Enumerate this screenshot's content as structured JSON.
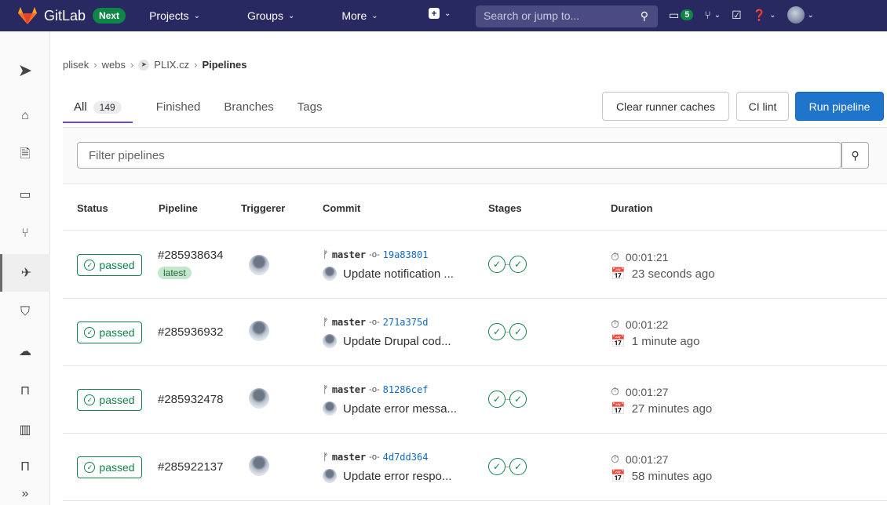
{
  "topbar": {
    "brand": "GitLab",
    "badge": "Next",
    "nav": [
      {
        "label": "Projects"
      },
      {
        "label": "Groups"
      },
      {
        "label": "More"
      }
    ],
    "search_placeholder": "Search or jump to...",
    "issues_count": "5"
  },
  "breadcrumb": {
    "items": [
      "plisek",
      "webs",
      "PLIX.cz"
    ],
    "current": "Pipelines"
  },
  "tabs": [
    {
      "label": "All",
      "count": "149"
    },
    {
      "label": "Finished"
    },
    {
      "label": "Branches"
    },
    {
      "label": "Tags"
    }
  ],
  "actions": {
    "clear_cache": "Clear runner caches",
    "ci_lint": "CI lint",
    "run_pipeline": "Run pipeline"
  },
  "filter": {
    "placeholder": "Filter pipelines"
  },
  "table": {
    "headers": {
      "status": "Status",
      "pipeline": "Pipeline",
      "triggerer": "Triggerer",
      "commit": "Commit",
      "stages": "Stages",
      "duration": "Duration"
    },
    "rows": [
      {
        "status": "passed",
        "id": "#285938634",
        "latest": "latest",
        "branch": "master",
        "sha": "19a83801",
        "message": "Update notification ...",
        "duration": "00:01:21",
        "finished": "23 seconds ago"
      },
      {
        "status": "passed",
        "id": "#285936932",
        "branch": "master",
        "sha": "271a375d",
        "message": "Update Drupal cod...",
        "duration": "00:01:22",
        "finished": "1 minute ago"
      },
      {
        "status": "passed",
        "id": "#285932478",
        "branch": "master",
        "sha": "81286cef",
        "message": "Update error messa...",
        "duration": "00:01:27",
        "finished": "27 minutes ago"
      },
      {
        "status": "passed",
        "id": "#285922137",
        "branch": "master",
        "sha": "4d7dd364",
        "message": "Update error respo...",
        "duration": "00:01:27",
        "finished": "58 minutes ago"
      }
    ]
  },
  "colors": {
    "navbar": "#292961",
    "success": "#108548",
    "primary": "#1f75cb",
    "tab_underline": "#6e49cb"
  }
}
